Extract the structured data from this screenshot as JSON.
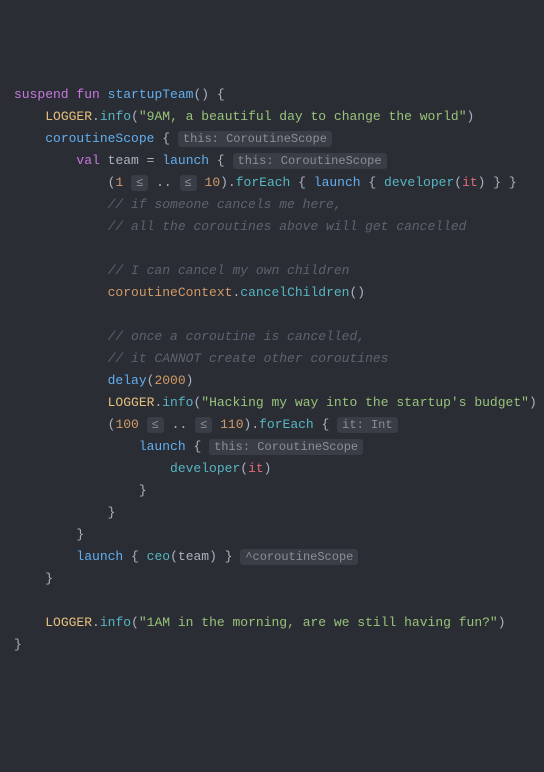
{
  "code": {
    "l1": {
      "suspend": "suspend",
      "fun": "fun",
      "name": "startupTeam"
    },
    "l2": {
      "logger": "LOGGER",
      "info": "info",
      "msg": "\"9AM, a beautiful day to change the world\""
    },
    "l3": {
      "scope": "coroutineScope",
      "hint": "this: CoroutineScope"
    },
    "l4": {
      "val": "val",
      "team": "team",
      "launch": "launch",
      "hint": "this: CoroutineScope"
    },
    "l5": {
      "one": "1",
      "ten": "10",
      "forEach": "forEach",
      "launch": "launch",
      "developer": "developer",
      "it": "it"
    },
    "l6": {
      "cm": "// if someone cancels me here,"
    },
    "l7": {
      "cm": "// all the coroutines above will get cancelled"
    },
    "l9": {
      "cm": "// I can cancel my own children"
    },
    "l10": {
      "ctx": "coroutineContext",
      "cancel": "cancelChildren"
    },
    "l12": {
      "cm": "// once a coroutine is cancelled,"
    },
    "l13": {
      "cm": "// it CANNOT create other coroutines"
    },
    "l14": {
      "delay": "delay",
      "ms": "2000"
    },
    "l15": {
      "logger": "LOGGER",
      "info": "info",
      "msg": "\"Hacking my way into the startup's budget\""
    },
    "l16": {
      "lo": "100",
      "hi": "110",
      "forEach": "forEach",
      "hint": "it: Int"
    },
    "l17": {
      "launch": "launch",
      "hint": "this: CoroutineScope"
    },
    "l18": {
      "developer": "developer",
      "it": "it"
    },
    "l22": {
      "launch": "launch",
      "ceo": "ceo",
      "team": "team",
      "hint": "^coroutineScope"
    },
    "l25": {
      "logger": "LOGGER",
      "info": "info",
      "msg": "\"1AM in the morning, are we still having fun?\""
    }
  },
  "op": {
    "le": "≤",
    "range": ".."
  }
}
